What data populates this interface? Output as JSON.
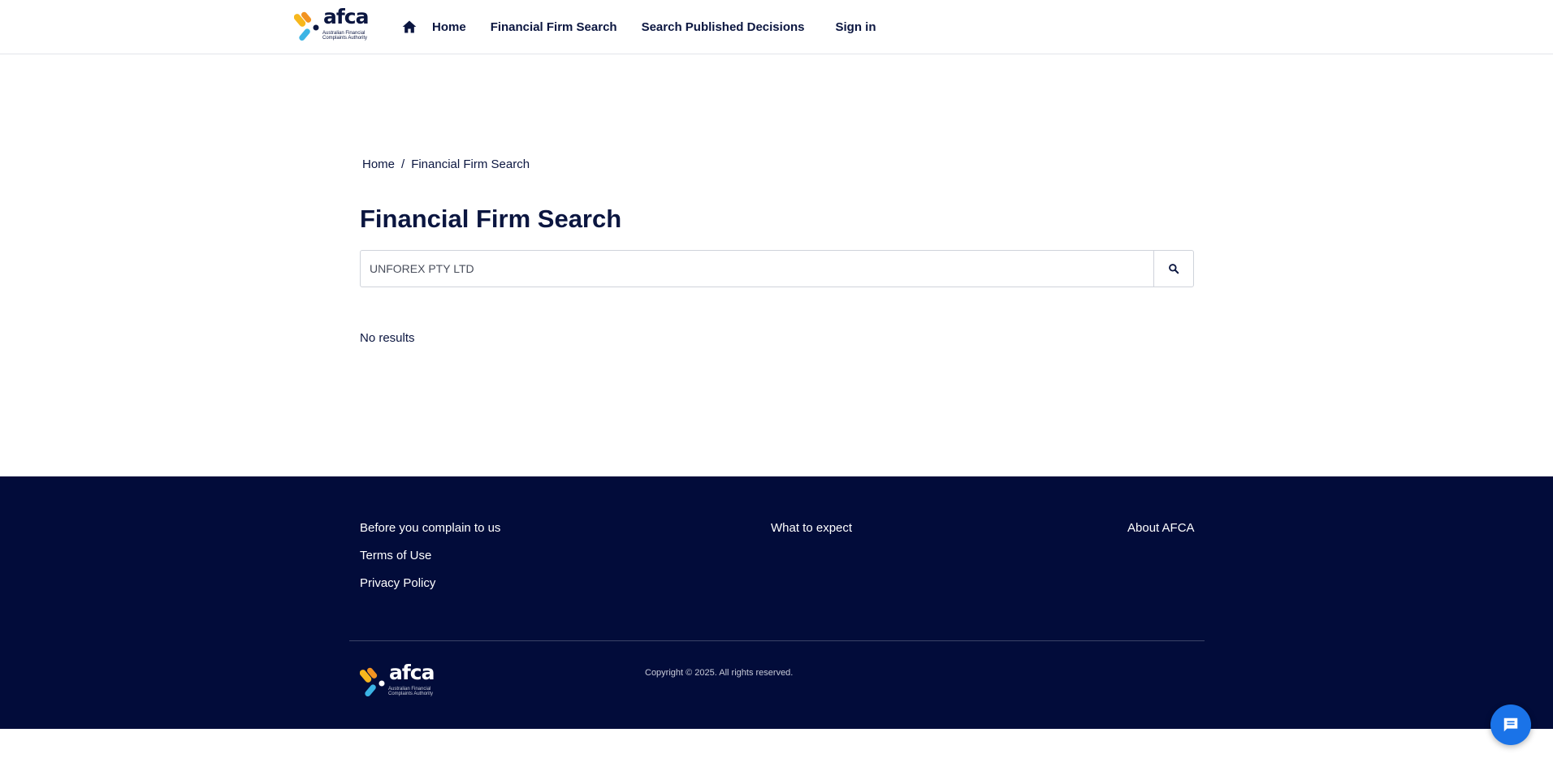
{
  "header": {
    "logo_word": "afca",
    "logo_sub": "Australian Financial Complaints Authority",
    "nav": {
      "home_icon": "home-icon",
      "home": "Home",
      "firm_search": "Financial Firm Search",
      "decisions": "Search Published Decisions",
      "sign_in": "Sign in"
    }
  },
  "breadcrumb": {
    "home": "Home",
    "separator": "/",
    "current": "Financial Firm Search"
  },
  "main": {
    "title": "Financial Firm Search",
    "search_value": "UNFOREX PTY LTD",
    "search_icon": "search-icon",
    "no_results": "No results"
  },
  "footer": {
    "col1": [
      "Before you complain to us",
      "Terms of Use",
      "Privacy Policy"
    ],
    "col2": [
      "What to expect"
    ],
    "col3": [
      "About AFCA"
    ],
    "logo_word": "afca",
    "logo_sub": "Australian Financial Complaints Authority",
    "copyright": "Copyright © 2025. All rights reserved."
  },
  "chat": {
    "icon": "chat-icon"
  },
  "colors": {
    "navy": "#020c3a",
    "text": "#0b1640",
    "logo_yellow": "#f7b71d",
    "logo_orange": "#f29321",
    "logo_blue": "#3bb4e5",
    "chat_blue": "#1a73e8"
  }
}
